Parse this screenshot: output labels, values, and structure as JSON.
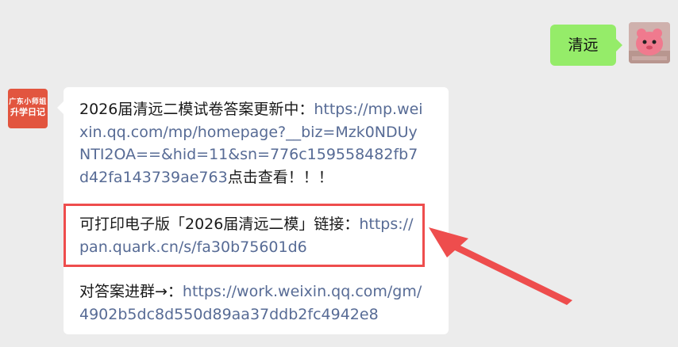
{
  "chat": {
    "sent_message": {
      "text": "清远"
    },
    "received_avatar": {
      "line1": "广东小师姐",
      "line2": "升学日记"
    },
    "received_message": {
      "para1_prefix": "2026届清远二模试卷答案更新中：",
      "para1_link": "https://mp.weixin.qq.com/mp/homepage?__biz=Mzk0NDUyNTI2OA==&hid=11&sn=776c159558482fb7d42fa143739ae763",
      "para1_suffix": "点击查看！！！",
      "para2_prefix": "可打印电子版「2026届清远二模」链接：",
      "para2_link": "https://pan.quark.cn/s/fa30b75601d6",
      "para3_prefix": "对答案进群→：",
      "para3_link": "https://work.weixin.qq.com/gm/4902b5dc8d550d89aa37ddb2fc4942e8"
    }
  },
  "colors": {
    "highlight": "#ee4d4d",
    "link": "#576b95",
    "sent_bubble": "#95ec69"
  }
}
